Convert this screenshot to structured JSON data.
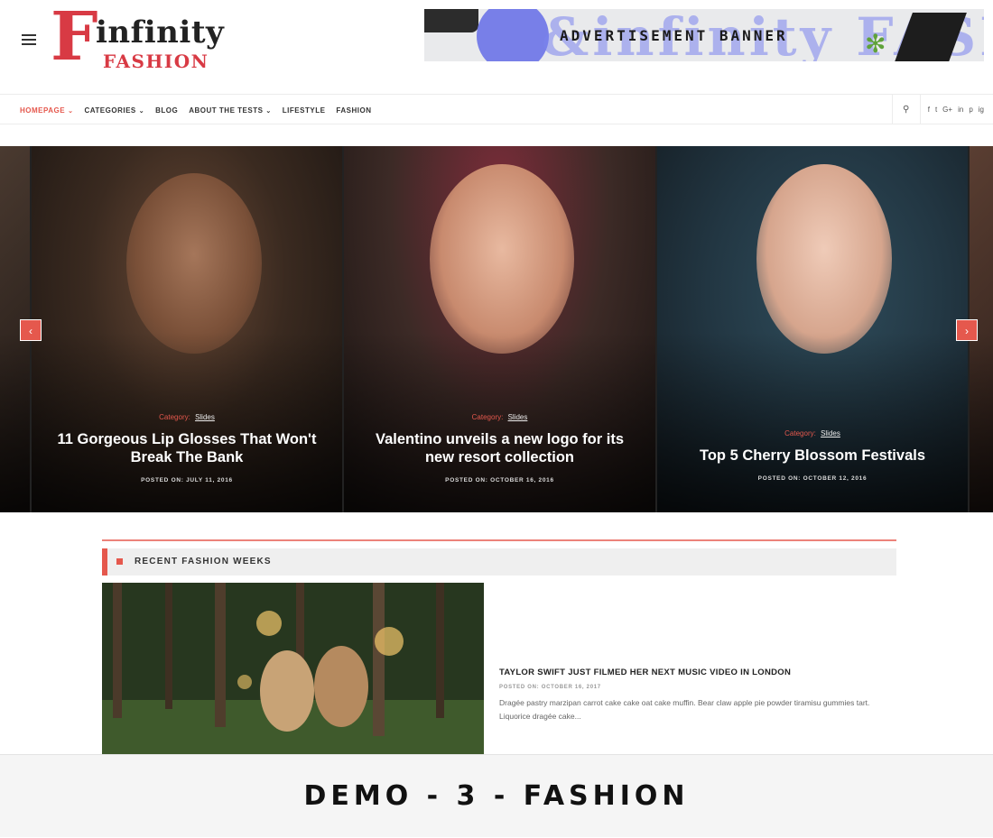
{
  "header": {
    "logo": {
      "letter": "F",
      "word1": "infinity",
      "word2": "FASHION"
    },
    "ad": {
      "ghost_text": "&infinity FASHION",
      "text": "ADVERTISEMENT BANNER"
    }
  },
  "nav": {
    "items": [
      {
        "label": "HOMEPAGE",
        "caret": true,
        "active": true
      },
      {
        "label": "CATEGORIES",
        "caret": true
      },
      {
        "label": "BLOG",
        "caret": false
      },
      {
        "label": "ABOUT THE TESTS",
        "caret": true
      },
      {
        "label": "LIFESTYLE",
        "caret": false
      },
      {
        "label": "FASHION",
        "caret": false
      }
    ],
    "socials": [
      "f",
      "t",
      "G+",
      "in",
      "p",
      "ig"
    ]
  },
  "slider": {
    "slides": [
      {
        "category_label": "Category:",
        "category_value": "Slides",
        "title": "11 Gorgeous Lip Glosses That Won't Break The Bank",
        "date": "POSTED ON: JULY 11, 2016"
      },
      {
        "category_label": "Category:",
        "category_value": "Slides",
        "title": "Valentino unveils a new logo for its new resort collection",
        "date": "POSTED ON: OCTOBER 16, 2016"
      },
      {
        "category_label": "Category:",
        "category_value": "Slides",
        "title": "Top 5 Cherry Blossom Festivals",
        "date": "POSTED ON: OCTOBER 12, 2016"
      }
    ],
    "prev_arrow": "‹",
    "next_arrow": "›"
  },
  "recent": {
    "section_title": "RECENT FASHION WEEKS",
    "post": {
      "title": "TAYLOR SWIFT JUST FILMED HER NEXT MUSIC VIDEO IN LONDON",
      "date": "POSTED ON: OCTOBER 16, 2017",
      "excerpt": "Dragée pastry marzipan carrot cake cake oat cake muffin. Bear claw apple pie powder tiramisu gummies tart. Liquorice dragée cake..."
    }
  },
  "caption": "DEMO - 3 - FASHION",
  "colors": {
    "accent": "#e5584d",
    "logo_red": "#d83a44"
  }
}
